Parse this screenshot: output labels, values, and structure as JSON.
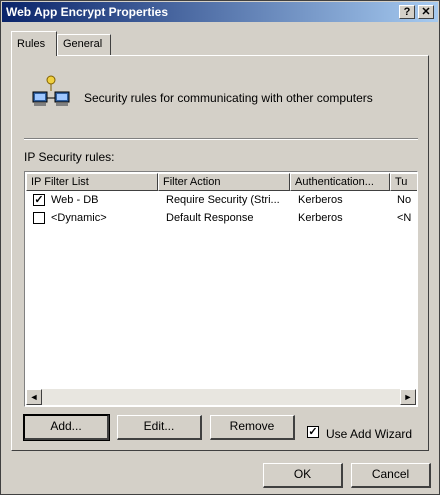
{
  "window": {
    "title": "Web App Encrypt Properties",
    "help_button": "?",
    "close_button": "✕"
  },
  "tabs": [
    {
      "label": "Rules",
      "active": true
    },
    {
      "label": "General",
      "active": false
    }
  ],
  "description": "Security rules for communicating with other computers",
  "ip_rules_label": "IP Security rules:",
  "table": {
    "columns": [
      "IP Filter List",
      "Filter Action",
      "Authentication...",
      "Tu"
    ],
    "rows": [
      {
        "checked": true,
        "filter_list": "Web - DB",
        "filter_action": "Require Security (Stri...",
        "auth": "Kerberos",
        "tunnel": "No"
      },
      {
        "checked": false,
        "filter_list": "<Dynamic>",
        "filter_action": "Default Response",
        "auth": "Kerberos",
        "tunnel": "<N"
      }
    ]
  },
  "buttons": {
    "add": "Add...",
    "edit": "Edit...",
    "remove": "Remove",
    "ok": "OK",
    "cancel": "Cancel"
  },
  "use_add_wizard": {
    "label": "Use Add Wizard",
    "checked": true
  },
  "scroll_left": "◄",
  "scroll_right": "►"
}
